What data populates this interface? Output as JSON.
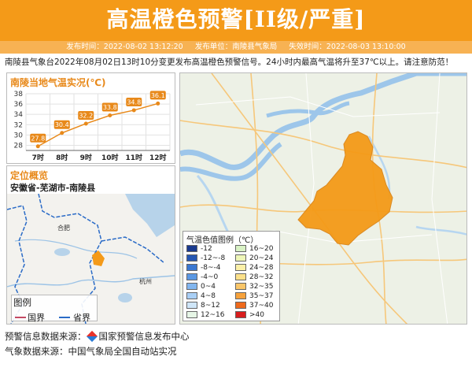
{
  "header": {
    "title": "高温橙色预警[II级/严重]",
    "bg_color": "#f49a18"
  },
  "meta": {
    "issue_time": "发布时间：2022-08-02 13:12:20",
    "issuer": "发布单位：南陵县气象局",
    "expire_time": "失效时间：2022-08-03 13:10:00"
  },
  "notice": "南陵县气象台2022年08月02日13时10分变更发布高温橙色预警信号。24小时内最高气温将升至37℃以上。请注意防范！",
  "temp_panel": {
    "title": "南陵当地气温实况(℃)"
  },
  "chart_data": {
    "type": "line",
    "categories": [
      "7时",
      "8时",
      "9时",
      "10时",
      "11时",
      "12时"
    ],
    "series": [
      {
        "values": [
          27.8,
          30.4,
          32.2,
          33.8,
          34.8,
          36.1
        ]
      }
    ],
    "yticks": [
      28,
      30,
      32,
      34,
      36,
      38
    ],
    "ylim": [
      27,
      38
    ],
    "color": "#e8891a",
    "grid": true
  },
  "location_panel": {
    "title": "定位概览",
    "path": "安徽省-芜湖市-南陵县",
    "map_labels": {
      "hefei": "合肥",
      "hangzhou": "杭州"
    },
    "legend_title": "图例",
    "legend_national": "国界",
    "legend_provincial": "省界"
  },
  "color_legend": {
    "title": "气温色值图例（℃）",
    "items": [
      {
        "label": "-12",
        "color": "#1a3a8f"
      },
      {
        "label": "16~20",
        "color": "#d9f2c5"
      },
      {
        "label": "-12~-8",
        "color": "#2657b3"
      },
      {
        "label": "20~24",
        "color": "#eef6b8"
      },
      {
        "label": "-8~-4",
        "color": "#3b78d1"
      },
      {
        "label": "24~28",
        "color": "#fbf0a8"
      },
      {
        "label": "-4~0",
        "color": "#5b98e3"
      },
      {
        "label": "28~32",
        "color": "#fbe08a"
      },
      {
        "label": "0~4",
        "color": "#82b6ef"
      },
      {
        "label": "32~35",
        "color": "#f9c66a"
      },
      {
        "label": "4~8",
        "color": "#a9cff5"
      },
      {
        "label": "35~37",
        "color": "#f6a23c"
      },
      {
        "label": "8~12",
        "color": "#cfe6f8"
      },
      {
        "label": "37~40",
        "color": "#ee6a1c"
      },
      {
        "label": "12~16",
        "color": "#e6f6e6"
      },
      {
        "label": ">40",
        "color": "#d81e1e"
      }
    ]
  },
  "footer": {
    "warning_source": "预警信息数据来源：",
    "warning_org": "国家预警信息发布中心",
    "weather_source": "气象数据来源：中国气象局全国自动站实况"
  }
}
